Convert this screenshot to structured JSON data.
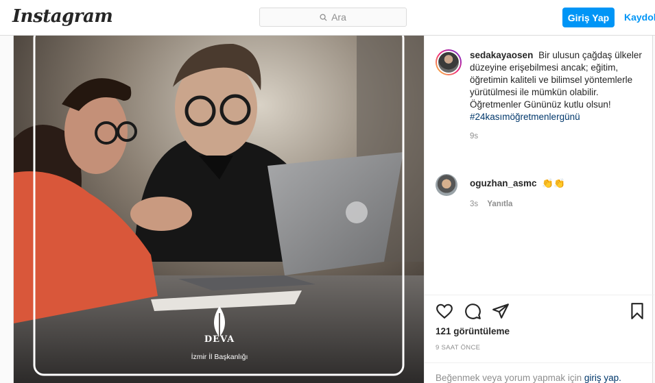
{
  "header": {
    "logo": "Instagram",
    "search_placeholder": "Ara",
    "login_label": "Giriş Yap",
    "signup_label": "Kaydol"
  },
  "media": {
    "org_name": "DEVA",
    "org_subtitle": "İzmir İl Başkanlığı"
  },
  "caption": {
    "username": "sedakayaosen",
    "text": "Bir ulusun çağdaş ülkeler düzeyine erişebilmesi ancak; eğitim, öğretimin kaliteli ve bilimsel yöntemlerle yürütülmesi ile mümkün olabilir. Öğretmenler Gününüz kutlu olsun!",
    "hashtag": "#24kasımöğretmenlergünü",
    "time": "9s"
  },
  "comment": {
    "username": "oguzhan_asmc",
    "text": "👏👏",
    "time": "3s",
    "reply_label": "Yanıtla"
  },
  "stats": {
    "views": "121 görüntüleme",
    "posted": "9 SAAT ÖNCE"
  },
  "footer": {
    "prompt_prefix": "Beğenmek veya yorum yapmak için",
    "prompt_link": "giriş yap."
  },
  "icons": [
    "like-icon",
    "comment-icon",
    "share-icon",
    "save-icon",
    "search-icon"
  ]
}
